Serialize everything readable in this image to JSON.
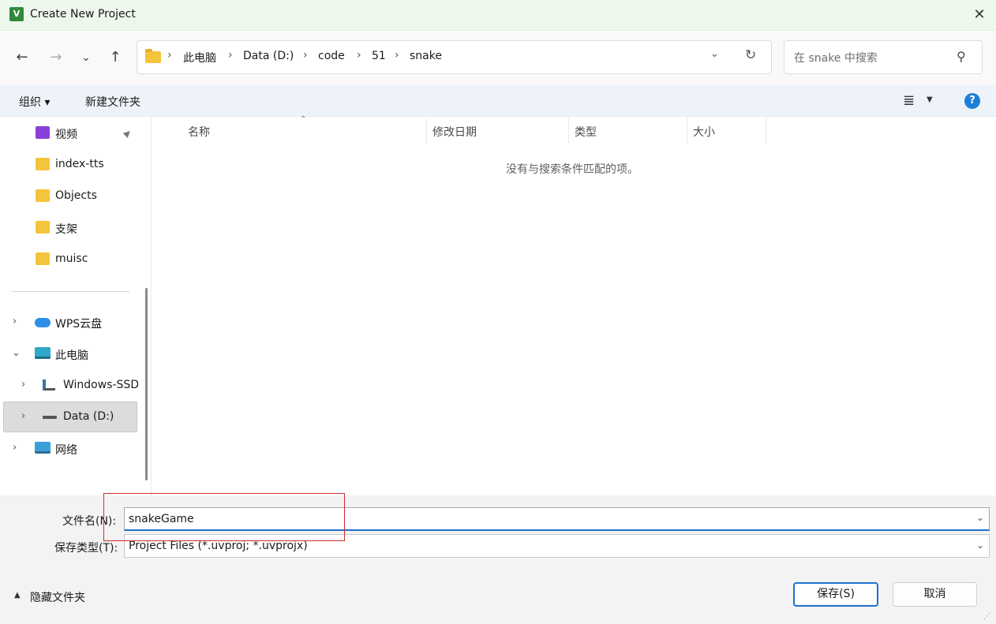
{
  "window": {
    "title": "Create New Project",
    "app_icon_letter": "V",
    "close_glyph": "✕"
  },
  "nav": {
    "back_glyph": "←",
    "forward_glyph": "→",
    "recent_glyph": "⌄",
    "up_glyph": "↑",
    "breadcrumbs": [
      "此电脑",
      "Data (D:)",
      "code",
      "51",
      "snake"
    ],
    "sep_glyph": "›",
    "dropdown_glyph": "⌄",
    "refresh_glyph": "↻",
    "search_placeholder": "在 snake 中搜索",
    "search_glyph": "⚲"
  },
  "toolbar": {
    "organize_label": "组织 ▾",
    "new_folder_label": "新建文件夹",
    "view_glyph": "≣",
    "view_caret": "▼",
    "help_glyph": "?"
  },
  "sidebar": {
    "items": [
      {
        "label": "视频",
        "icon": "video-icon"
      },
      {
        "label": "index-tts",
        "icon": "folder-icon"
      },
      {
        "label": "Objects",
        "icon": "folder-icon"
      },
      {
        "label": "支架",
        "icon": "folder-icon"
      },
      {
        "label": "muisc",
        "icon": "folder-icon"
      },
      {
        "label": "WPS云盘",
        "icon": "cloud-icon",
        "caret": "›"
      },
      {
        "label": "此电脑",
        "icon": "pc-icon",
        "caret": "⌄"
      },
      {
        "label": "Windows-SSD",
        "icon": "windows-drive-icon",
        "caret": "›"
      },
      {
        "label": "Data (D:)",
        "icon": "drive-icon",
        "caret": "›"
      },
      {
        "label": "网络",
        "icon": "network-icon",
        "caret": "›"
      }
    ],
    "pin_glyph": "📌"
  },
  "list": {
    "columns": [
      "名称",
      "修改日期",
      "类型",
      "大小"
    ],
    "sort_glyph": "⌃",
    "empty_message": "没有与搜索条件匹配的项。"
  },
  "bottom": {
    "filename_label": "文件名(N):",
    "filename_value": "snakeGame",
    "filetype_label": "保存类型(T):",
    "filetype_value": "Project Files (*.uvproj; *.uvprojx)",
    "combo_glyph": "⌄",
    "hide_folders_label": "隐藏文件夹",
    "hide_caret": "▲",
    "save_label": "保存(S)",
    "cancel_label": "取消"
  },
  "colors": {
    "accent": "#1f6fd1",
    "highlight": "#d12b2b",
    "folder": "#f4c43b"
  }
}
